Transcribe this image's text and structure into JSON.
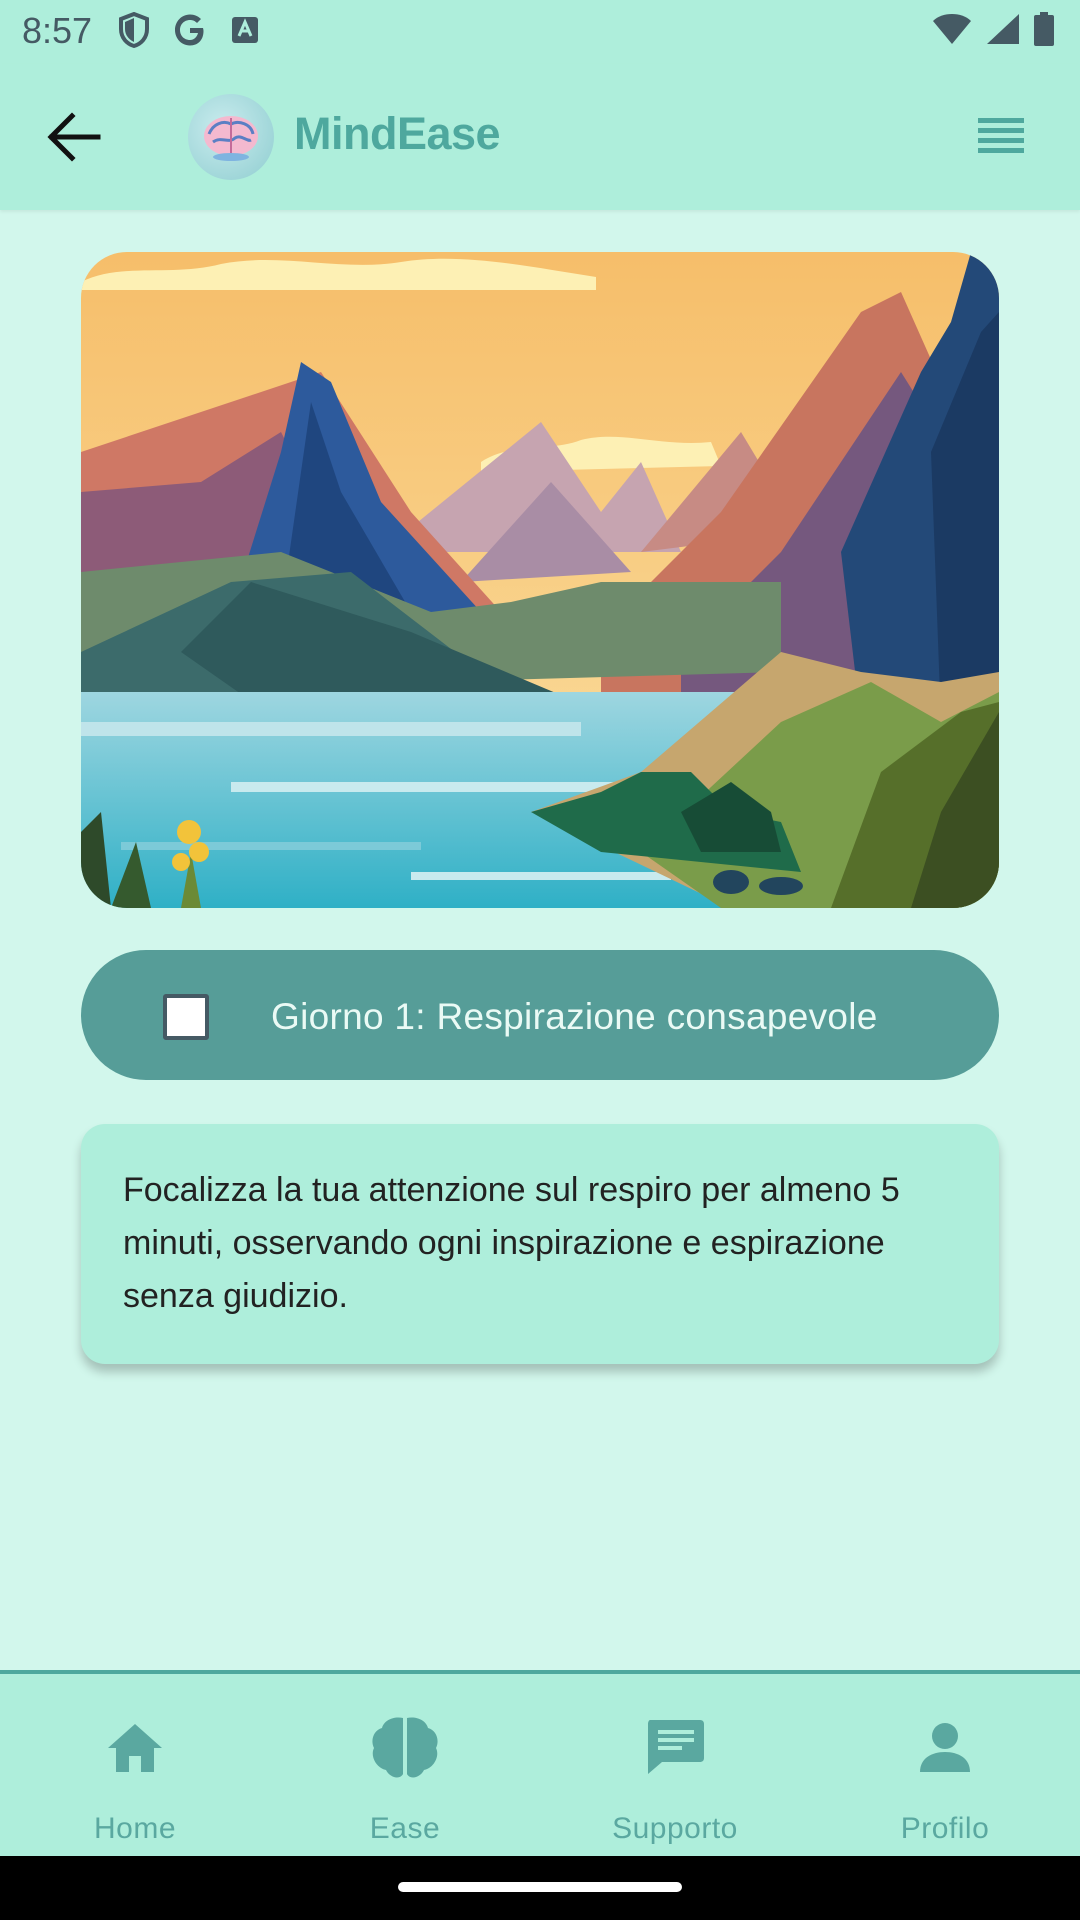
{
  "status_bar": {
    "time": "8:57",
    "left_icons": [
      "shield-icon",
      "google-icon",
      "a-badge-icon"
    ],
    "right_icons": [
      "wifi-icon",
      "signal-icon",
      "battery-icon"
    ]
  },
  "app_bar": {
    "title": "MindEase",
    "back_icon": "arrow-back-icon",
    "menu_icon": "menu-icon",
    "title_color": "#4ea89e",
    "background": "#aeeedb"
  },
  "hero_image": {
    "alt": "mountain-lake-landscape"
  },
  "task": {
    "label": "Giorno 1: Respirazione consapevole",
    "checked": false,
    "pill_color": "#569d98"
  },
  "description": {
    "text": "Focalizza la tua attenzione sul respiro per almeno 5 minuti, osservando ogni inspirazione e espirazione senza giudizio."
  },
  "bottom_nav": {
    "items": [
      {
        "label": "Home",
        "icon": "home-icon"
      },
      {
        "label": "Ease",
        "icon": "brain-icon"
      },
      {
        "label": "Supporto",
        "icon": "chat-icon"
      },
      {
        "label": "Profilo",
        "icon": "person-icon"
      }
    ],
    "accent": "#5aa8a0"
  }
}
